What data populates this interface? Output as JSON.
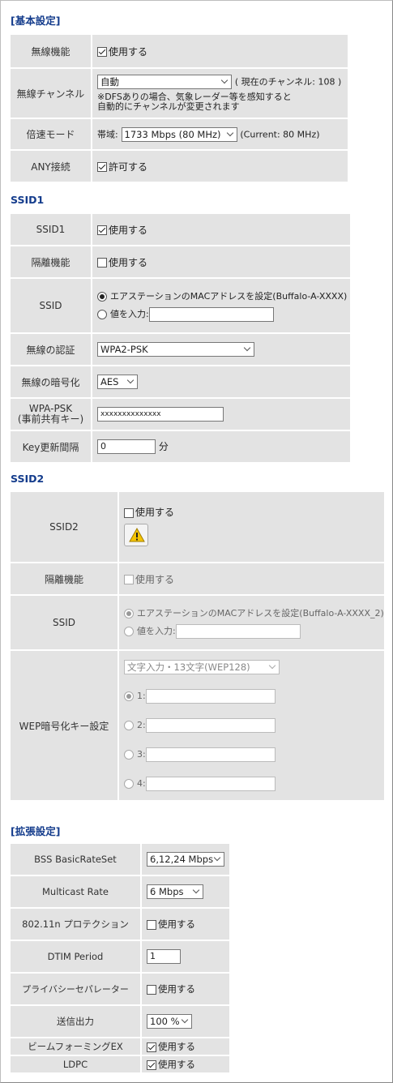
{
  "basic": {
    "header": "[基本設定]",
    "wireless_function": {
      "label": "無線機能",
      "check_label": "使用する",
      "checked": true
    },
    "channel": {
      "label": "無線チャンネル",
      "value": "自動",
      "current": "( 現在のチャンネル:  108 )",
      "note1": "※DFSありの場合、気象レーダー等を感知すると",
      "note2": "自動的にチャンネルが変更されます"
    },
    "speed_mode": {
      "label": "倍速モード",
      "prefix": "帯域:",
      "value": "1733 Mbps (80 MHz)",
      "current": "(Current: 80 MHz)"
    },
    "any": {
      "label": "ANY接続",
      "check_label": "許可する",
      "checked": true
    }
  },
  "ssid1": {
    "header": "SSID1",
    "enable": {
      "label": "SSID1",
      "check_label": "使用する",
      "checked": true
    },
    "isolation": {
      "label": "隔離機能",
      "check_label": "使用する",
      "checked": false
    },
    "ssid": {
      "label": "SSID",
      "option1": "エアステーションのMACアドレスを設定(Buffalo-A-XXXX)",
      "option2": "値を入力:",
      "input_value": ""
    },
    "auth": {
      "label": "無線の認証",
      "value": "WPA2-PSK"
    },
    "encryption": {
      "label": "無線の暗号化",
      "value": "AES"
    },
    "psk": {
      "label1": "WPA-PSK",
      "label2": "(事前共有キー)",
      "value": "xxxxxxxxxxxxxx"
    },
    "key_interval": {
      "label": "Key更新間隔",
      "value": "0",
      "unit": "分"
    }
  },
  "ssid2": {
    "header": "SSID2",
    "enable": {
      "label": "SSID2",
      "check_label": "使用する",
      "checked": false
    },
    "isolation": {
      "label": "隔離機能",
      "check_label": "使用する",
      "checked": false
    },
    "ssid": {
      "label": "SSID",
      "option1": "エアステーションのMACアドレスを設定(Buffalo-A-XXXX_2)",
      "option2": "値を入力:"
    },
    "wep": {
      "label": "WEP暗号化キー設定",
      "select": "文字入力・13文字(WEP128)",
      "keys": [
        "1:",
        "2:",
        "3:",
        "4:"
      ]
    }
  },
  "extended": {
    "header": "[拡張設定]",
    "bss": {
      "label": "BSS BasicRateSet",
      "value": "6,12,24 Mbps"
    },
    "multicast": {
      "label": "Multicast Rate",
      "value": "6 Mbps"
    },
    "protection": {
      "label": "802.11n プロテクション",
      "check_label": "使用する",
      "checked": false
    },
    "dtim": {
      "label": "DTIM Period",
      "value": "1"
    },
    "privacy": {
      "label": "プライバシーセパレーター",
      "check_label": "使用する",
      "checked": false
    },
    "tx_power": {
      "label": "送信出力",
      "value": "100 %"
    },
    "beamforming": {
      "label": "ビームフォーミングEX",
      "check_label": "使用する",
      "checked": true
    },
    "ldpc": {
      "label": "LDPC",
      "check_label": "使用する",
      "checked": true
    }
  },
  "colors": {
    "header": "#143c8c",
    "row_bg": "#e3e3e3",
    "warn": "#f5c400"
  }
}
